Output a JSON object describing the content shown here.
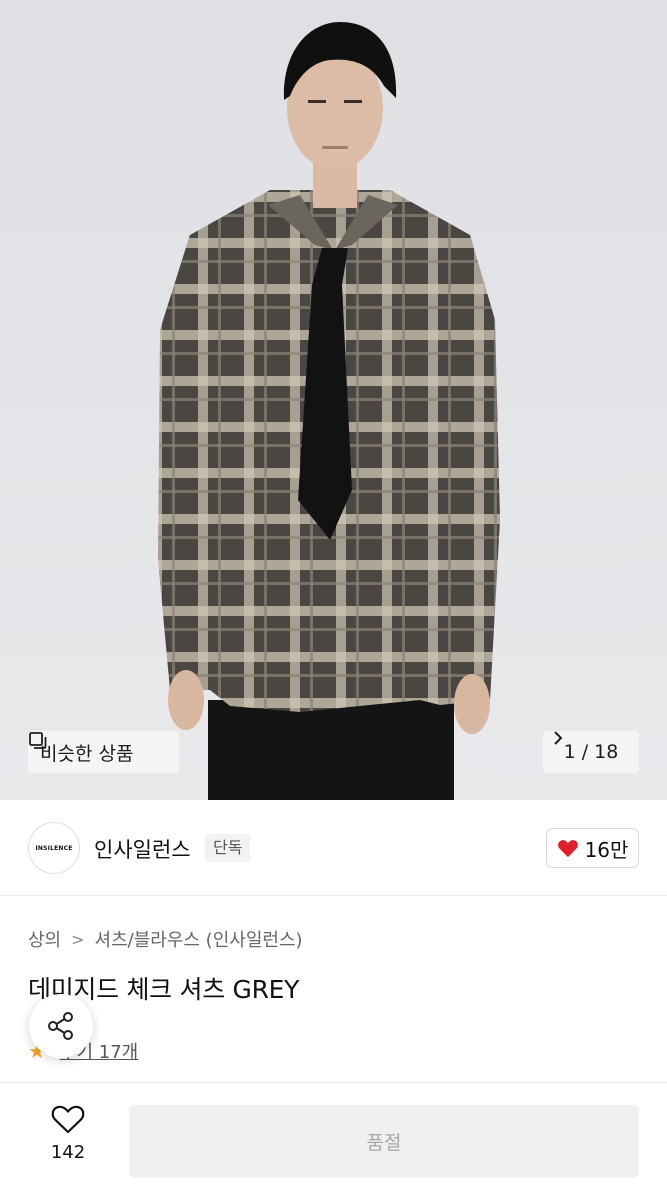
{
  "hero": {
    "similar_label": "비슷한 상품",
    "counter_current": "1",
    "counter_total": "18",
    "counter_separator": "/"
  },
  "brand": {
    "logo_text": "INSILENCE",
    "name": "인사일런스",
    "badge": "단독",
    "like_count": "16만"
  },
  "product": {
    "breadcrumb": [
      "상의",
      "셔츠/블라우스 (인사일런스)"
    ],
    "breadcrumb_separator": ">",
    "title": "데미지드 체크 셔츠 GREY",
    "review_label": "후기 17개"
  },
  "bottom_bar": {
    "wish_count": "142",
    "action_label": "품절"
  },
  "colors": {
    "heart": "#e0202a",
    "star": "#f5a623",
    "soldout_bg": "#f0f0f0"
  }
}
